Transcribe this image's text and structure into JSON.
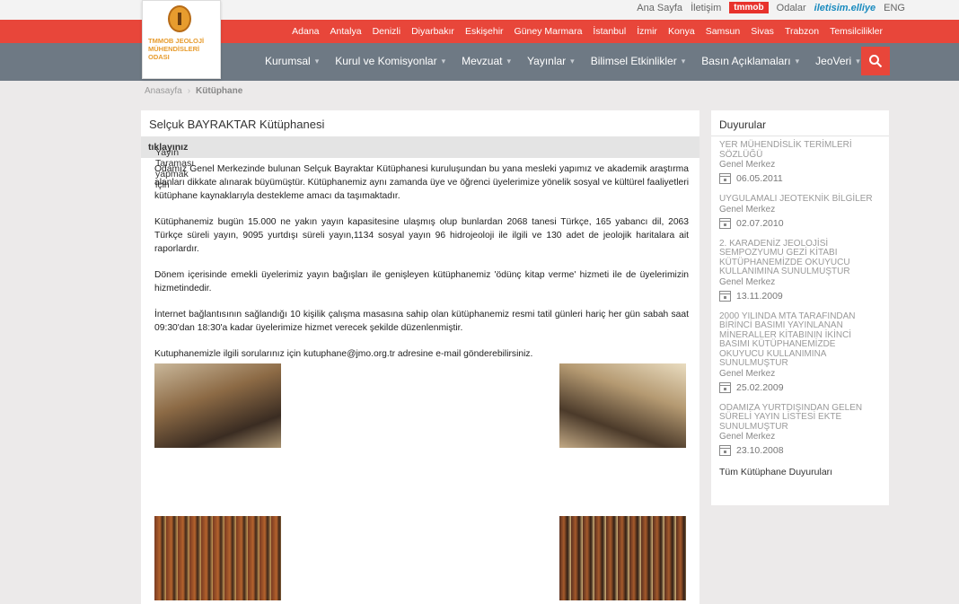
{
  "logo": {
    "text": "TMMOB JEOLOJİ MÜHENDİSLERİ ODASI"
  },
  "top_links": {
    "home": "Ana Sayfa",
    "contact": "İletişim",
    "tmmob": "tmmob",
    "rooms": "Odalar",
    "mlink": "iletisim.elliye",
    "eng": "ENG"
  },
  "cities": [
    "Adana",
    "Antalya",
    "Denizli",
    "Diyarbakır",
    "Eskişehir",
    "Güney Marmara",
    "İstanbul",
    "İzmir",
    "Konya",
    "Samsun",
    "Sivas",
    "Trabzon",
    "Temsilcilikler"
  ],
  "nav": [
    "Kurumsal",
    "Kurul ve Komisyonlar",
    "Mevzuat",
    "Yayınlar",
    "Bilimsel Etkinlikler",
    "Basın Açıklamaları",
    "JeoVeri"
  ],
  "breadcrumb": {
    "home": "Anasayfa",
    "current": "Kütüphane"
  },
  "main": {
    "title": "Selçuk BAYRAKTAR Kütüphanesi",
    "subbar_prefix": "Yayın Taraması yapmak için ",
    "subbar_link": "tıklayınız",
    "paragraphs": [
      "Odamız Genel Merkezinde bulunan Selçuk Bayraktar Kütüphanesi kuruluşundan bu yana mesleki yapımız ve akademik araştırma alanları dikkate alınarak büyümüştür. Kütüphanemiz aynı zamanda üye ve öğrenci üyelerimize yönelik sosyal ve kültürel faaliyetleri kütüphane kaynaklarıyla destekleme amacı da taşımaktadır.",
      "Kütüphanemiz bugün 15.000 ne yakın yayın kapasitesine ulaşmış olup bunlardan 2068 tanesi Türkçe, 165 yabancı dil, 2063 Türkçe süreli yayın, 9095 yurtdışı süreli yayın,1134 sosyal yayın 96 hidrojeoloji ile ilgili ve 130 adet de jeolojik haritalara ait raporlardır.",
      "Dönem içerisinde emekli üyelerimiz yayın bağışları ile genişleyen kütüphanemiz 'ödünç kitap verme' hizmeti ile de üyelerimizin hizmetindedir.",
      "İnternet bağlantısının sağlandığı 10 kişilik çalışma masasına sahip olan kütüphanemiz resmi tatil günleri hariç her gün sabah saat 09:30'dan 18:30'a kadar üyelerimize hizmet verecek şekilde düzenlenmiştir.",
      "Kutuphanemizle ilgili sorularınız için kutuphane@jmo.org.tr adresine e-mail gönderebilirsiniz."
    ]
  },
  "sidebar": {
    "title": "Duyurular",
    "items": [
      {
        "title": "YER MÜHENDİSLİK TERİMLERİ SÖZLÜĞÜ",
        "source": "Genel Merkez",
        "date": "06.05.2011"
      },
      {
        "title": "UYGULAMALI JEOTEKNİK BİLGİLER",
        "source": "Genel Merkez",
        "date": "02.07.2010"
      },
      {
        "title": "2. KARADENİZ JEOLOJİSİ SEMPOZYUMU GEZİ KİTABI KÜTÜPHANEMİZDE OKUYUCU KULLANIMINA SUNULMUŞTUR",
        "source": "Genel Merkez",
        "date": "13.11.2009"
      },
      {
        "title": "2000 YILINDA MTA TARAFINDAN BİRİNCİ BASIMI YAYINLANAN MİNERALLER KİTABININ İKİNCİ BASIMI KÜTÜPHANEMİZDE OKUYUCU KULLANIMINA SUNULMUŞTUR",
        "source": "Genel Merkez",
        "date": "25.02.2009"
      },
      {
        "title": "ODAMIZA YURTDIŞINDAN GELEN SÜRELİ YAYIN LİSTESİ EKTE SUNULMUŞTUR",
        "source": "Genel Merkez",
        "date": "23.10.2008"
      }
    ],
    "all_link": "Tüm Kütüphane Duyuruları"
  },
  "colors": {
    "red": "#e8463a",
    "nav": "#6e7984",
    "logo_orange": "#e79c2e"
  }
}
